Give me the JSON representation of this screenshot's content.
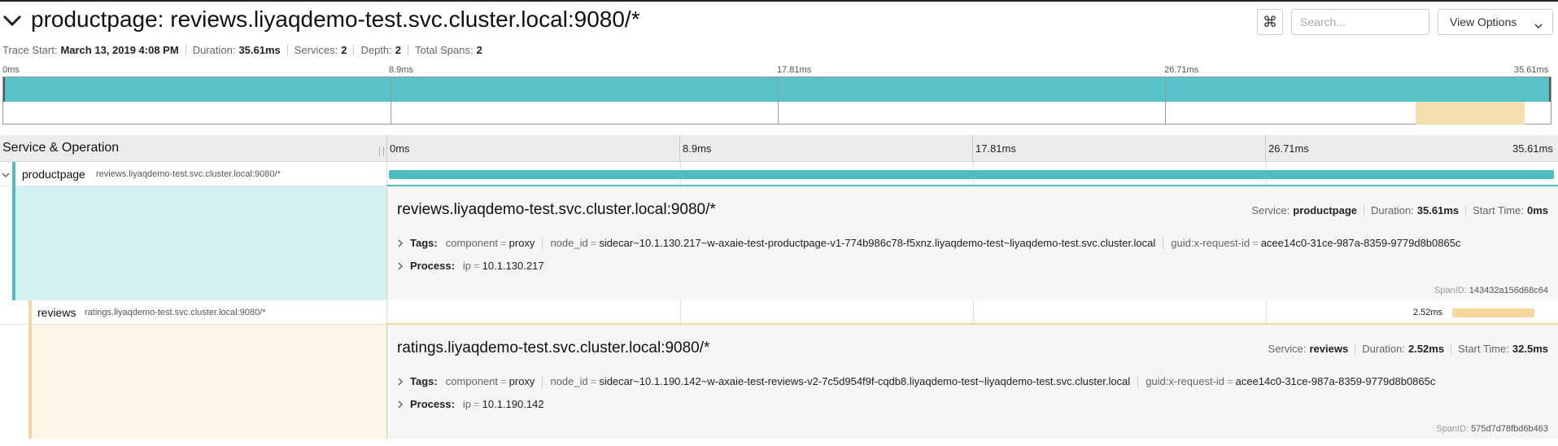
{
  "header": {
    "title": "productpage: reviews.liyaqdemo-test.svc.cluster.local:9080/*",
    "kbd_icon": "⌘",
    "search_placeholder": "Search...",
    "view_options_label": "View Options"
  },
  "meta": {
    "trace_start_label": "Trace Start:",
    "trace_start": "March 13, 2019 4:08 PM",
    "duration_label": "Duration:",
    "duration": "35.61ms",
    "services_label": "Services:",
    "services": "2",
    "depth_label": "Depth:",
    "depth": "2",
    "total_spans_label": "Total Spans:",
    "total_spans": "2"
  },
  "ticks": [
    "0ms",
    "8.9ms",
    "17.81ms",
    "26.71ms",
    "35.61ms"
  ],
  "timeline": {
    "service_operation_label": "Service & Operation"
  },
  "colors": {
    "productpage": "#4fbcc2",
    "productpage_light": "#d3f0f2",
    "reviews": "#f5d99c",
    "reviews_light": "#fdf5e6"
  },
  "spans": [
    {
      "service": "productpage",
      "operation": "reviews.liyaqdemo-test.svc.cluster.local:9080/*",
      "start_ms": 0,
      "duration_ms": 35.61,
      "duration_text": "",
      "detail": {
        "title": "reviews.liyaqdemo-test.svc.cluster.local:9080/*",
        "service_label": "Service:",
        "service": "productpage",
        "duration_label": "Duration:",
        "duration": "35.61ms",
        "start_label": "Start Time:",
        "start": "0ms",
        "tags_label": "Tags:",
        "tags": [
          {
            "k": "component",
            "v": "proxy"
          },
          {
            "k": "node_id",
            "v": "sidecar~10.1.130.217~w-axaie-test-productpage-v1-774b986c78-f5xnz.liyaqdemo-test~liyaqdemo-test.svc.cluster.local"
          },
          {
            "k": "guid:x-request-id",
            "v": "acee14c0-31ce-987a-8359-9779d8b0865c"
          }
        ],
        "process_label": "Process:",
        "process": [
          {
            "k": "ip",
            "v": "10.1.130.217"
          }
        ],
        "span_id_label": "SpanID:",
        "span_id": "143432a156d68c64"
      }
    },
    {
      "service": "reviews",
      "operation": "ratings.liyaqdemo-test.svc.cluster.local:9080/*",
      "start_ms": 32.5,
      "duration_ms": 2.52,
      "duration_text": "2.52ms",
      "detail": {
        "title": "ratings.liyaqdemo-test.svc.cluster.local:9080/*",
        "service_label": "Service:",
        "service": "reviews",
        "duration_label": "Duration:",
        "duration": "2.52ms",
        "start_label": "Start Time:",
        "start": "32.5ms",
        "tags_label": "Tags:",
        "tags": [
          {
            "k": "component",
            "v": "proxy"
          },
          {
            "k": "node_id",
            "v": "sidecar~10.1.190.142~w-axaie-test-reviews-v2-7c5d954f9f-cqdb8.liyaqdemo-test~liyaqdemo-test.svc.cluster.local"
          },
          {
            "k": "guid:x-request-id",
            "v": "acee14c0-31ce-987a-8359-9779d8b0865c"
          }
        ],
        "process_label": "Process:",
        "process": [
          {
            "k": "ip",
            "v": "10.1.190.142"
          }
        ],
        "span_id_label": "SpanID:",
        "span_id": "575d7d78fbd6b463"
      }
    }
  ]
}
